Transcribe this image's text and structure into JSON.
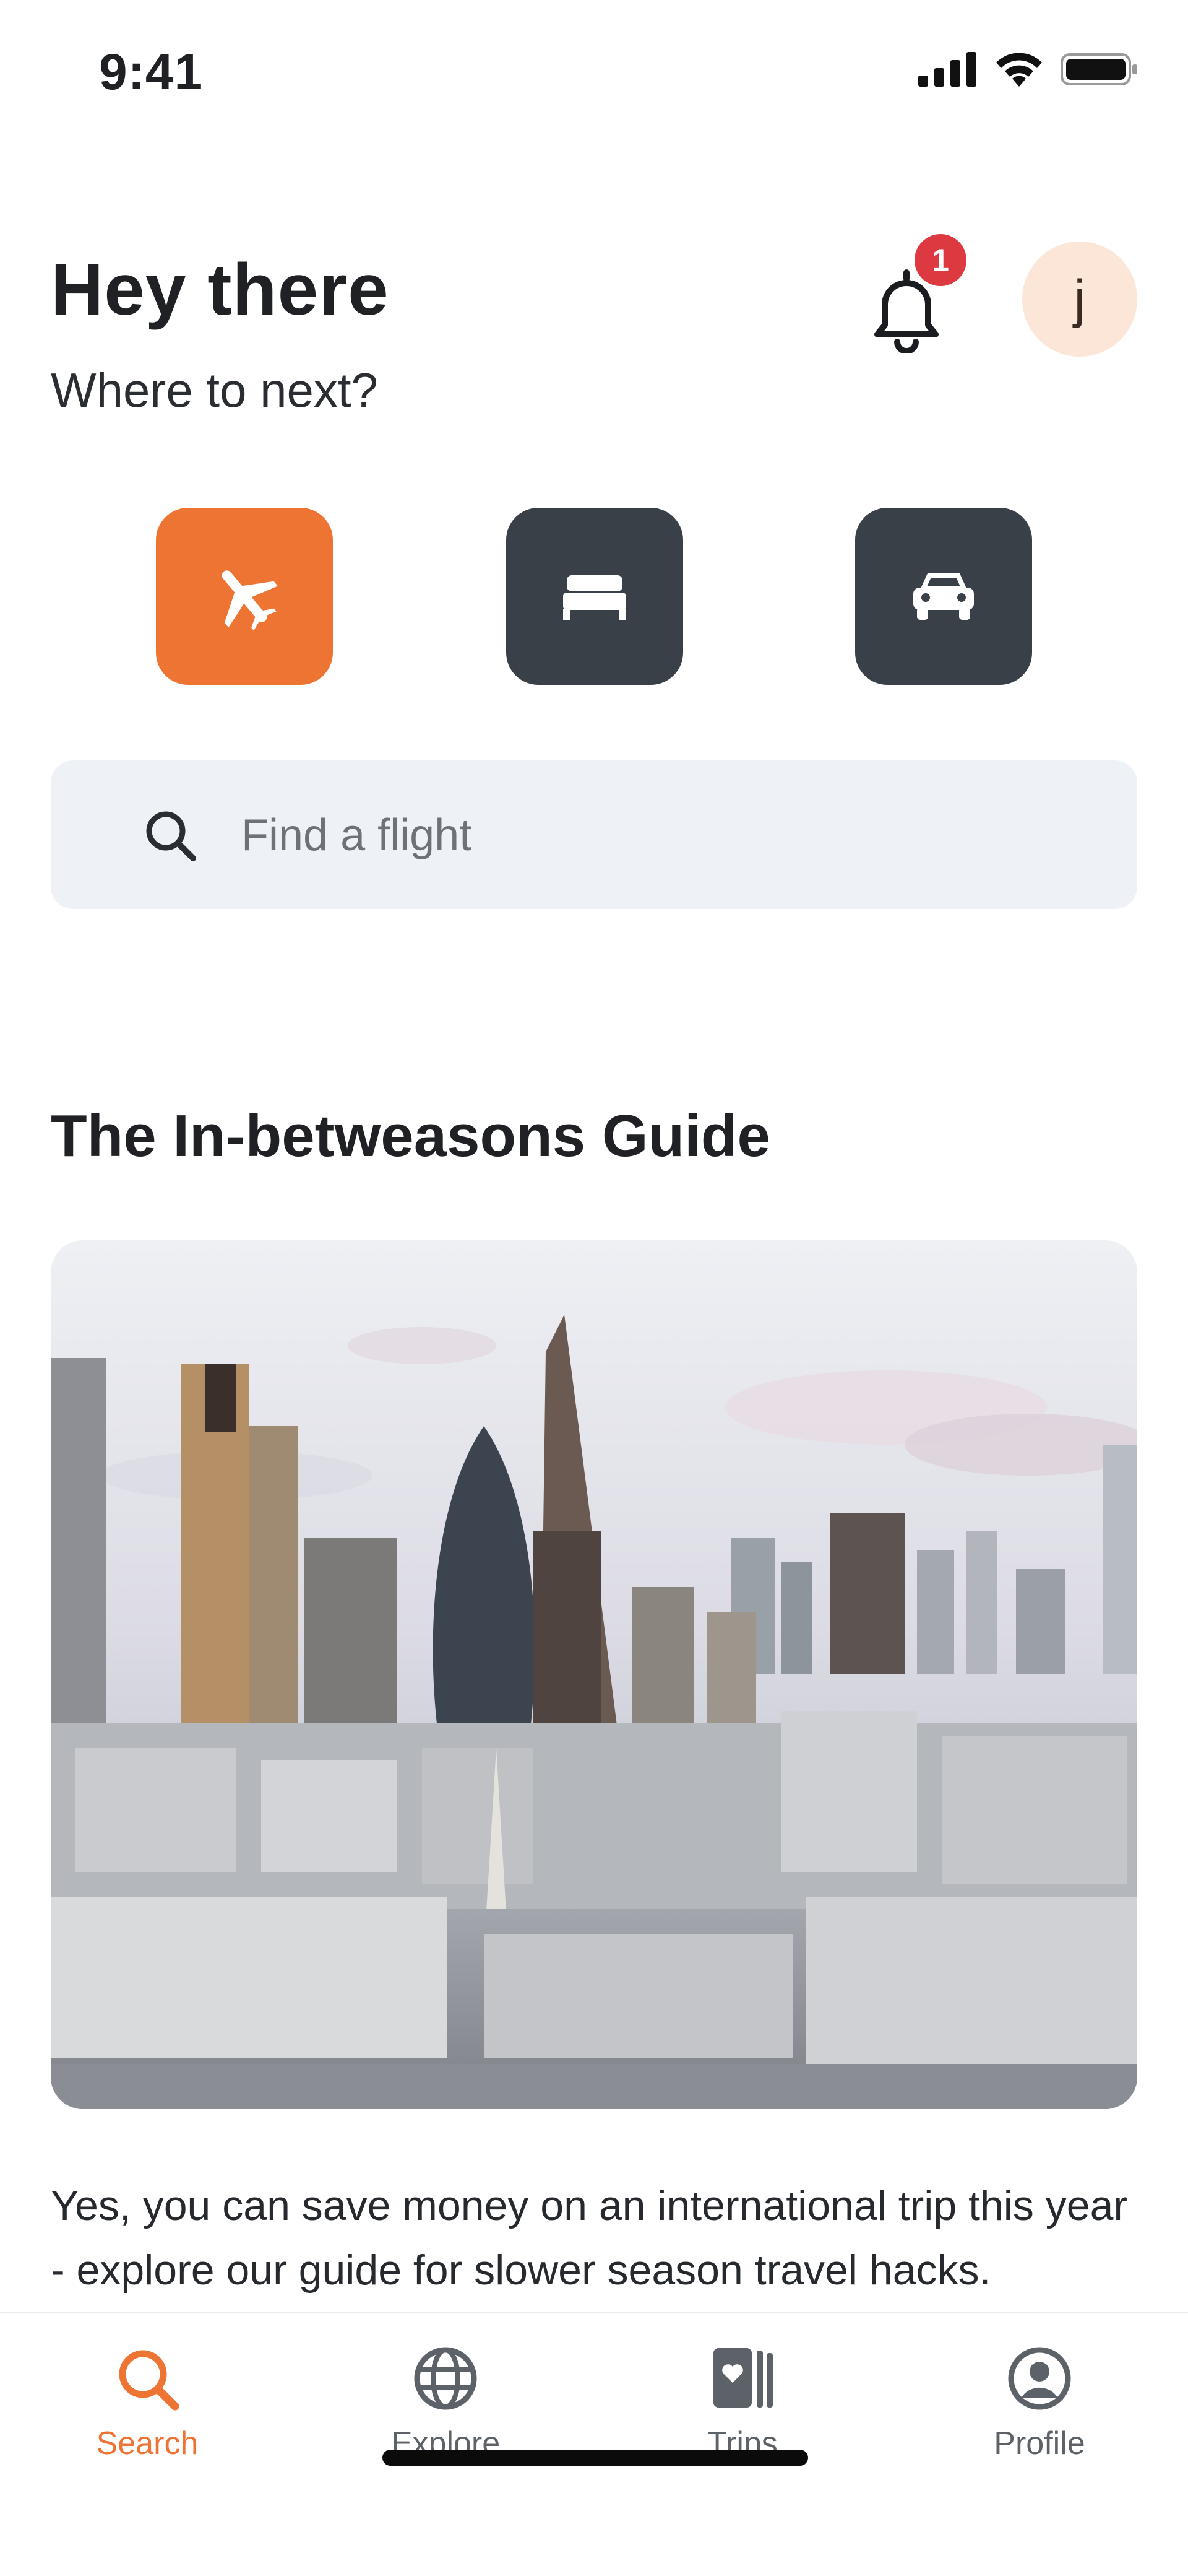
{
  "status_bar": {
    "time": "9:41"
  },
  "header": {
    "greeting": "Hey there",
    "subtitle": "Where to next?",
    "notification_count": "1",
    "avatar_initial": "j"
  },
  "modes": [
    {
      "name": "flights",
      "icon": "airplane-icon",
      "active": true
    },
    {
      "name": "hotels",
      "icon": "bed-icon",
      "active": false
    },
    {
      "name": "cars",
      "icon": "car-icon",
      "active": false
    }
  ],
  "search": {
    "placeholder": "Find a flight"
  },
  "guide": {
    "title": "The In-betweasons Guide",
    "description": "Yes, you can save money on an international trip this year - explore our guide for slower season travel hacks."
  },
  "tabbar": {
    "items": [
      {
        "label": "Search",
        "icon": "search-icon",
        "active": true
      },
      {
        "label": "Explore",
        "icon": "globe-icon",
        "active": false
      },
      {
        "label": "Trips",
        "icon": "trips-icon",
        "active": false
      },
      {
        "label": "Profile",
        "icon": "profile-icon",
        "active": false
      }
    ]
  },
  "colors": {
    "accent": "#ee7433",
    "dark_button": "#3a4047",
    "badge": "#dc3a40",
    "search_bg": "#eef1f5"
  }
}
